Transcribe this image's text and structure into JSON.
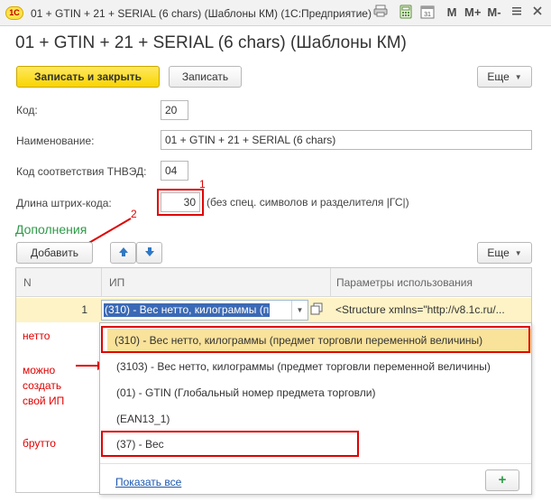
{
  "window": {
    "logo_text": "1C",
    "title": "01 + GTIN + 21 + SERIAL (6 chars) (Шаблоны КМ)  (1С:Предприятие)",
    "icons": [
      "print-icon",
      "calculator-icon",
      "calendar-icon",
      "memory-icon",
      "memory-plus-icon",
      "memory-minus-icon",
      "menu-icon",
      "close-icon"
    ],
    "m_label": "M",
    "m_plus_label": "M+",
    "m_minus_label": "M-",
    "calendar_text": "31"
  },
  "page": {
    "title": "01 + GTIN + 21 + SERIAL (6 chars) (Шаблоны КМ)"
  },
  "toolbar": {
    "save_close_label": "Записать и закрыть",
    "save_label": "Записать",
    "more_label": "Еще"
  },
  "form": {
    "code_label": "Код:",
    "code_value": "20",
    "name_label": "Наименование:",
    "name_value": "01 + GTIN + 21 + SERIAL (6 chars)",
    "tnved_label": "Код соответствия ТНВЭД:",
    "tnved_value": "04",
    "barcode_label": "Длина штрих-кода:",
    "barcode_value": "30",
    "barcode_note": "(без спец. символов и разделителя |ГС|)"
  },
  "annotations": {
    "num1": "1",
    "num2": "2",
    "netto": "нетто",
    "create_line1": "можно",
    "create_line2": "создать",
    "create_line3": "свой ИП",
    "brutto": "брутто"
  },
  "additions": {
    "title": "Дополнения",
    "add_label": "Добавить",
    "more_label": "Еще",
    "columns": [
      "N",
      "ИП",
      "Параметры использования"
    ],
    "row": {
      "n": "1",
      "ip": "(310) - Вес нетто, килограммы (п",
      "params": "<Structure xmlns=\"http://v8.1c.ru/..."
    }
  },
  "dropdown": {
    "items": [
      "(310) - Вес нетто, килограммы (предмет торговли переменной величины)",
      "(3103) - Вес нетто, килограммы (предмет торговли переменной величины)",
      "(01) - GTIN (Глобальный номер предмета торговли)",
      "(EAN13_1)",
      "(37) - Вес"
    ],
    "show_all": "Показать все",
    "add_symbol": "+"
  },
  "colors": {
    "accent_yellow": "#f8d500",
    "annotation_red": "#e00000",
    "section_green": "#2e9a48",
    "selected_row": "#fdf3c6",
    "link_blue": "#1a56b0"
  }
}
